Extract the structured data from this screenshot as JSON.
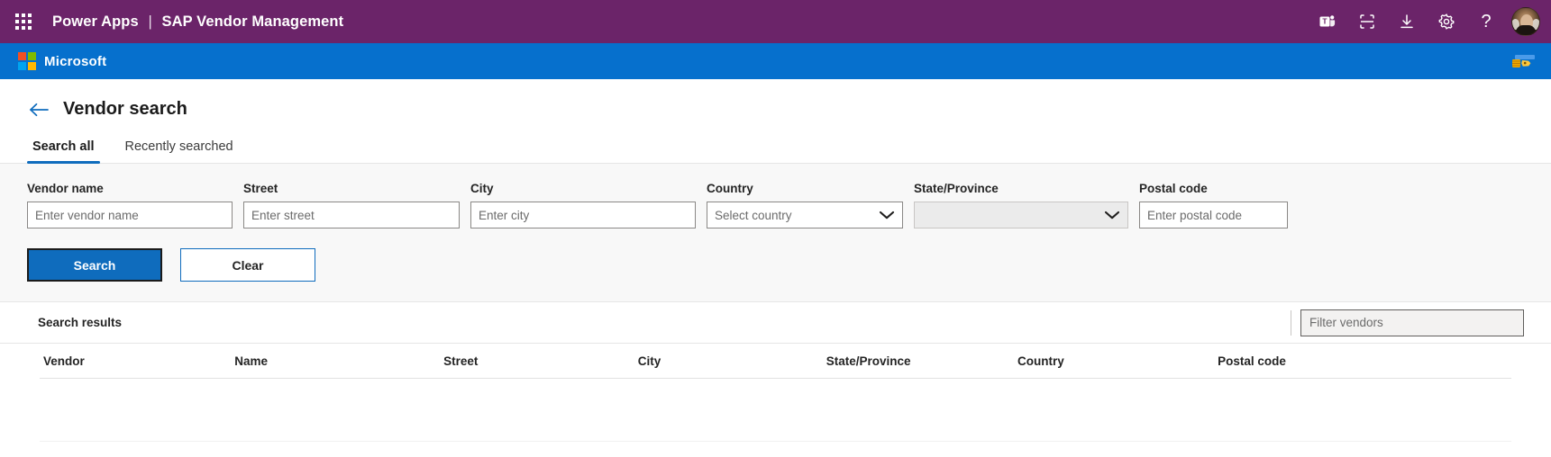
{
  "suite_bar": {
    "waffle_label": "app-launcher",
    "app_name": "Power Apps",
    "separator": "|",
    "solution_name": "SAP Vendor Management",
    "actions": [
      {
        "name": "teams-icon",
        "tooltip": "Teams"
      },
      {
        "name": "fullscreen-icon",
        "tooltip": "Full screen"
      },
      {
        "name": "download-icon",
        "tooltip": "Download"
      },
      {
        "name": "gear-icon",
        "tooltip": "Settings"
      },
      {
        "name": "help-icon",
        "tooltip": "Help",
        "glyph": "?"
      }
    ],
    "avatar_alt": "User account"
  },
  "brand_bar": {
    "logo_name": "microsoft-logo",
    "word_mark": "Microsoft",
    "right_art_name": "coins-illustration"
  },
  "page": {
    "back_label": "Back",
    "title": "Vendor search"
  },
  "tabs": [
    {
      "label": "Search all",
      "active": true
    },
    {
      "label": "Recently searched",
      "active": false
    }
  ],
  "search_form": {
    "fields": [
      {
        "name": "vendor-name",
        "label": "Vendor name",
        "placeholder": "Enter vendor name",
        "value": "",
        "type": "text"
      },
      {
        "name": "street",
        "label": "Street",
        "placeholder": "Enter street",
        "value": "",
        "type": "text"
      },
      {
        "name": "city",
        "label": "City",
        "placeholder": "Enter city",
        "value": "",
        "type": "text"
      },
      {
        "name": "country",
        "label": "Country",
        "placeholder": "Select country",
        "value": "",
        "type": "combobox",
        "disabled": false
      },
      {
        "name": "state-province",
        "label": "State/Province",
        "placeholder": "",
        "value": "",
        "type": "combobox",
        "disabled": true
      },
      {
        "name": "postal-code",
        "label": "Postal code",
        "placeholder": "Enter postal code",
        "value": "",
        "type": "text"
      }
    ],
    "search_button": "Search",
    "clear_button": "Clear"
  },
  "results": {
    "title": "Search results",
    "filter_placeholder": "Filter vendors",
    "filter_value": "",
    "columns": [
      "Vendor",
      "Name",
      "Street",
      "City",
      "State/Province",
      "Country",
      "Postal code"
    ],
    "rows": []
  },
  "colors": {
    "suite_purple": "#6b2469",
    "brand_blue": "#0670cd",
    "accent_blue": "#0f6cbd",
    "form_band": "#f8f8f8",
    "border": "#8a8886",
    "disabled_fill": "#ebebeb",
    "text_primary": "#242424"
  }
}
